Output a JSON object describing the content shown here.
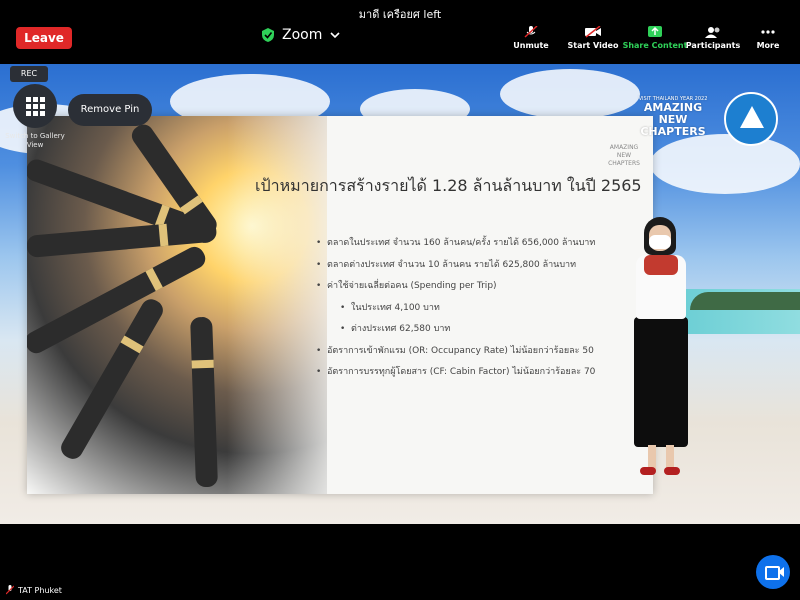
{
  "notification": {
    "text": "มาดี เครือยศ left"
  },
  "toolbar": {
    "leave_label": "Leave",
    "app_title": "Zoom",
    "buttons": [
      {
        "label": "Unmute",
        "icon": "mic-muted-icon"
      },
      {
        "label": "Start Video",
        "icon": "video-off-icon"
      },
      {
        "label": "Share Content",
        "icon": "share-icon",
        "color": "#2fd159"
      },
      {
        "label": "Participants",
        "icon": "participants-icon"
      },
      {
        "label": "More",
        "icon": "more-icon"
      }
    ]
  },
  "overlay": {
    "rec_label": "REC",
    "switch_label": "Switch to Gallery View",
    "remove_pin_label": "Remove Pin"
  },
  "logos": {
    "amazing_small": "VISIT THAILAND YEAR 2022",
    "amazing_main": "AMAZING NEW CHAPTERS"
  },
  "slide": {
    "logo_text": "AMAZING NEW CHAPTERS",
    "title": "เป้าหมายการสร้างรายได้ 1.28 ล้านล้านบาท ในปี 2565",
    "bullets": [
      {
        "text": "ตลาดในประเทศ จำนวน 160 ล้านคน/ครั้ง รายได้ 656,000 ล้านบาท",
        "level": 1
      },
      {
        "text": "ตลาดต่างประเทศ จำนวน 10 ล้านคน รายได้ 625,800 ล้านบาท",
        "level": 1
      },
      {
        "text": "ค่าใช้จ่ายเฉลี่ยต่อคน (Spending per Trip)",
        "level": 1
      },
      {
        "text": "ในประเทศ 4,100 บาท",
        "level": 2
      },
      {
        "text": "ต่างประเทศ 62,580 บาท",
        "level": 2
      },
      {
        "text": "อัตราการเข้าพักแรม (OR: Occupancy Rate) ไม่น้อยกว่าร้อยละ 50",
        "level": 1
      },
      {
        "text": "อัตราการบรรทุกผู้โดยสาร (CF: Cabin Factor) ไม่น้อยกว่าร้อยละ 70",
        "level": 1
      }
    ]
  },
  "bottom": {
    "participant_name": "TAT Phuket"
  },
  "colors": {
    "leave": "#e02828",
    "share": "#2fd159",
    "camera_button": "#0e71eb"
  }
}
